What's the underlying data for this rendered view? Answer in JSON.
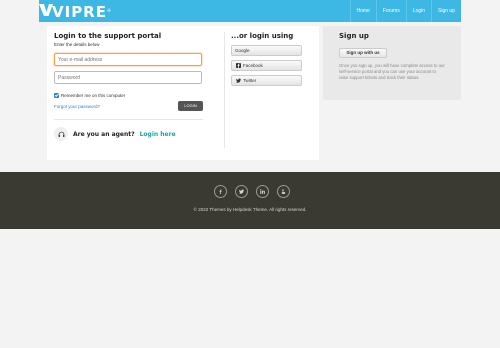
{
  "header": {
    "logo_text": "VIPRE",
    "brand_color": "#3db8e5",
    "nav": [
      {
        "label": "Home"
      },
      {
        "label": "Forums"
      },
      {
        "label": "Login"
      },
      {
        "label": "Sign up"
      }
    ]
  },
  "login": {
    "title": "Login to the support portal",
    "hint": "Enter the details below",
    "email_placeholder": "Your e-mail address",
    "password_placeholder": "Password",
    "remember_label": "Remember me on this computer",
    "remember_checked": true,
    "forgot_label": "Forgot your password?",
    "login_button": "LOGIN",
    "agent_question": "Are you an agent?",
    "agent_link": "Login here"
  },
  "social": {
    "title": "...or login using",
    "buttons": [
      {
        "label": "Google",
        "icon": "google-icon"
      },
      {
        "label": "Facebook",
        "icon": "facebook-icon"
      },
      {
        "label": "Twitter",
        "icon": "twitter-icon"
      }
    ]
  },
  "signup": {
    "title": "Sign up",
    "button": "Sign up with us",
    "description": "Once you sign up, you will have complete access to our self-service portal and you can use your account to raise support tickets and track their status."
  },
  "footer": {
    "social_icons": [
      "facebook-icon",
      "twitter-icon",
      "linkedin-icon",
      "youtube-icon"
    ],
    "copyright": "© 2022 Themes by Helpdesk Theme. All rights reserved."
  }
}
